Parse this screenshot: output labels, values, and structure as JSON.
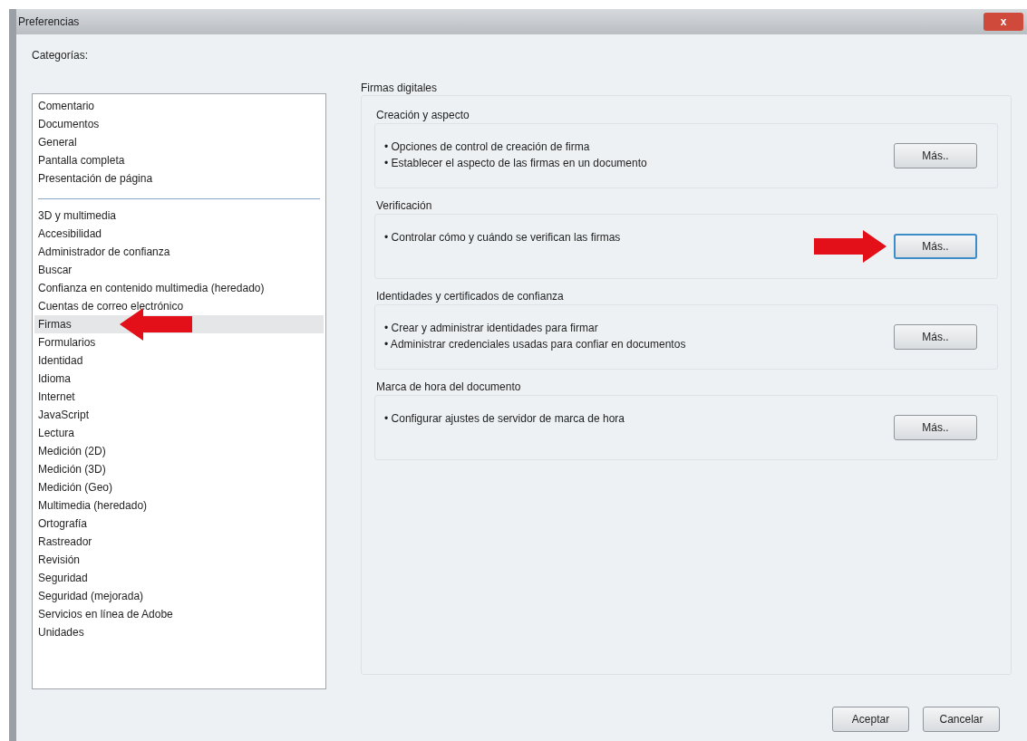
{
  "window": {
    "title": "Preferencias",
    "close": "x"
  },
  "categories": {
    "label": "Categorías:",
    "groups": [
      [
        {
          "label": "Comentario",
          "selected": false
        },
        {
          "label": "Documentos",
          "selected": false
        },
        {
          "label": "General",
          "selected": false
        },
        {
          "label": "Pantalla completa",
          "selected": false
        },
        {
          "label": "Presentación de página",
          "selected": false
        }
      ],
      [
        {
          "label": "3D y multimedia",
          "selected": false
        },
        {
          "label": "Accesibilidad",
          "selected": false
        },
        {
          "label": "Administrador de confianza",
          "selected": false
        },
        {
          "label": "Buscar",
          "selected": false
        },
        {
          "label": "Confianza en contenido multimedia (heredado)",
          "selected": false
        },
        {
          "label": "Cuentas de correo electrónico",
          "selected": false
        },
        {
          "label": "Firmas",
          "selected": true
        },
        {
          "label": "Formularios",
          "selected": false
        },
        {
          "label": "Identidad",
          "selected": false
        },
        {
          "label": "Idioma",
          "selected": false
        },
        {
          "label": "Internet",
          "selected": false
        },
        {
          "label": "JavaScript",
          "selected": false
        },
        {
          "label": "Lectura",
          "selected": false
        },
        {
          "label": "Medición (2D)",
          "selected": false
        },
        {
          "label": "Medición (3D)",
          "selected": false
        },
        {
          "label": "Medición (Geo)",
          "selected": false
        },
        {
          "label": "Multimedia (heredado)",
          "selected": false
        },
        {
          "label": "Ortografía",
          "selected": false
        },
        {
          "label": "Rastreador",
          "selected": false
        },
        {
          "label": "Revisión",
          "selected": false
        },
        {
          "label": "Seguridad",
          "selected": false
        },
        {
          "label": "Seguridad (mejorada)",
          "selected": false
        },
        {
          "label": "Servicios en línea de Adobe",
          "selected": false
        },
        {
          "label": "Unidades",
          "selected": false
        }
      ]
    ]
  },
  "panel": {
    "title": "Firmas digitales",
    "sections": [
      {
        "title": "Creación y aspecto",
        "lines": [
          "• Opciones de control de creación de firma",
          "• Establecer el aspecto de las firmas en un documento"
        ],
        "button": {
          "label": "Más..",
          "focused": false
        }
      },
      {
        "title": "Verificación",
        "lines": [
          "• Controlar cómo y cuándo se verifican las firmas"
        ],
        "button": {
          "label": "Más..",
          "focused": true
        }
      },
      {
        "title": "Identidades y certificados de confianza",
        "lines": [
          "• Crear y administrar identidades para firmar",
          "• Administrar credenciales usadas para confiar en documentos"
        ],
        "button": {
          "label": "Más..",
          "focused": false
        }
      },
      {
        "title": "Marca de hora del documento",
        "lines": [
          "• Configurar ajustes de servidor de marca de hora"
        ],
        "button": {
          "label": "Más..",
          "focused": false
        }
      }
    ]
  },
  "buttons": [
    "Aceptar",
    "Cancelar"
  ]
}
